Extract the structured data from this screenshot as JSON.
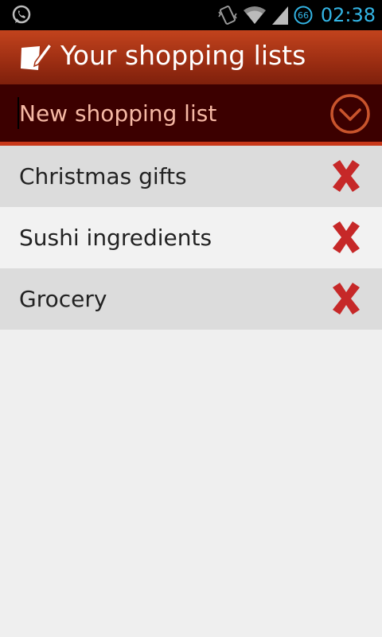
{
  "status_bar": {
    "time": "02:38",
    "battery_level": "66",
    "icons": [
      "whatsapp-icon",
      "vibrate-icon",
      "wifi-icon",
      "signal-icon",
      "battery-icon"
    ],
    "accent_color": "#33b5e5"
  },
  "header": {
    "title": "Your shopping lists",
    "icon": "note-icon"
  },
  "new_list": {
    "placeholder": "New shopping list",
    "add_icon": "chevron-down-circle-icon"
  },
  "lists": [
    {
      "name": "Christmas gifts"
    },
    {
      "name": "Sushi ingredients"
    },
    {
      "name": "Grocery"
    }
  ],
  "colors": {
    "header": "#a83416",
    "input_row": "#3c0000",
    "delete": "#c62828",
    "placeholder": "#f6b9a5"
  }
}
